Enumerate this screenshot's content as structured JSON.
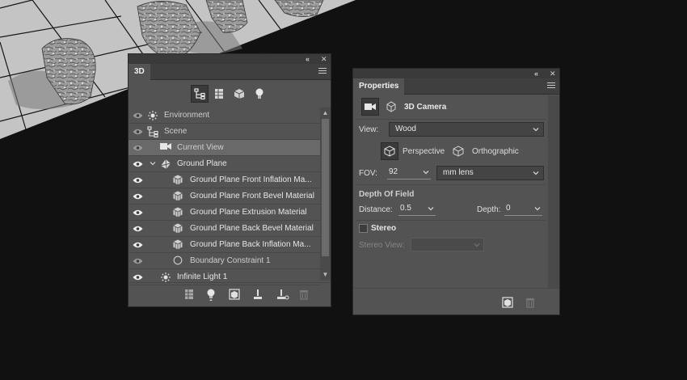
{
  "panel_3d": {
    "tab_title": "3D",
    "filters": [
      "whole-scene-filter",
      "meshes-filter",
      "materials-filter",
      "lights-filter"
    ],
    "layers": [
      {
        "label": "Environment",
        "icon": "environment-icon",
        "indent": 0,
        "expand": "",
        "eye": "dim"
      },
      {
        "label": "Scene",
        "icon": "scene-icon",
        "indent": 0,
        "expand": "",
        "eye": "dim"
      },
      {
        "label": "Current View",
        "icon": "camera-icon",
        "indent": 1,
        "expand": "",
        "eye": "dim",
        "selected": true
      },
      {
        "label": "Ground Plane",
        "icon": "mesh-icon",
        "indent": 1,
        "expand": "v",
        "eye": "on"
      },
      {
        "label": "Ground Plane Front Inflation Ma...",
        "icon": "material-icon",
        "indent": 2,
        "expand": "",
        "eye": "on"
      },
      {
        "label": "Ground Plane Front Bevel Material",
        "icon": "material-icon",
        "indent": 2,
        "expand": "",
        "eye": "on"
      },
      {
        "label": "Ground Plane Extrusion Material",
        "icon": "material-icon",
        "indent": 2,
        "expand": "",
        "eye": "on"
      },
      {
        "label": "Ground Plane Back Bevel Material",
        "icon": "material-icon",
        "indent": 2,
        "expand": "",
        "eye": "on"
      },
      {
        "label": "Ground Plane Back Inflation Ma...",
        "icon": "material-icon",
        "indent": 2,
        "expand": "",
        "eye": "on"
      },
      {
        "label": "Boundary Constraint 1",
        "icon": "constraint-icon",
        "indent": 2,
        "expand": "",
        "eye": "dim"
      },
      {
        "label": "Infinite Light 1",
        "icon": "infinite-light-icon",
        "indent": 1,
        "expand": "",
        "eye": "on"
      }
    ],
    "bottom_buttons": [
      "mesh-add-icon",
      "light-add-icon",
      "render-icon",
      "ground-icon",
      "constraint-add-icon",
      "trash-icon"
    ]
  },
  "properties": {
    "tab_title": "Properties",
    "header_title": "3D Camera",
    "view_label": "View:",
    "view_value": "Wood",
    "perspective_label": "Perspective",
    "orthographic_label": "Orthographic",
    "fov_label": "FOV:",
    "fov_value": "92",
    "lens_value": "mm lens",
    "dof_heading": "Depth Of Field",
    "distance_label": "Distance:",
    "distance_value": "0.5",
    "depth_label": "Depth:",
    "depth_value": "0",
    "stereo_label": "Stereo",
    "stereo_view_label": "Stereo View:",
    "stereo_checked": false
  },
  "colors": {
    "panel_bg": "#535353",
    "tab_bar": "#3f3f3f",
    "selected_row": "#696969",
    "workspace": "#111111"
  }
}
